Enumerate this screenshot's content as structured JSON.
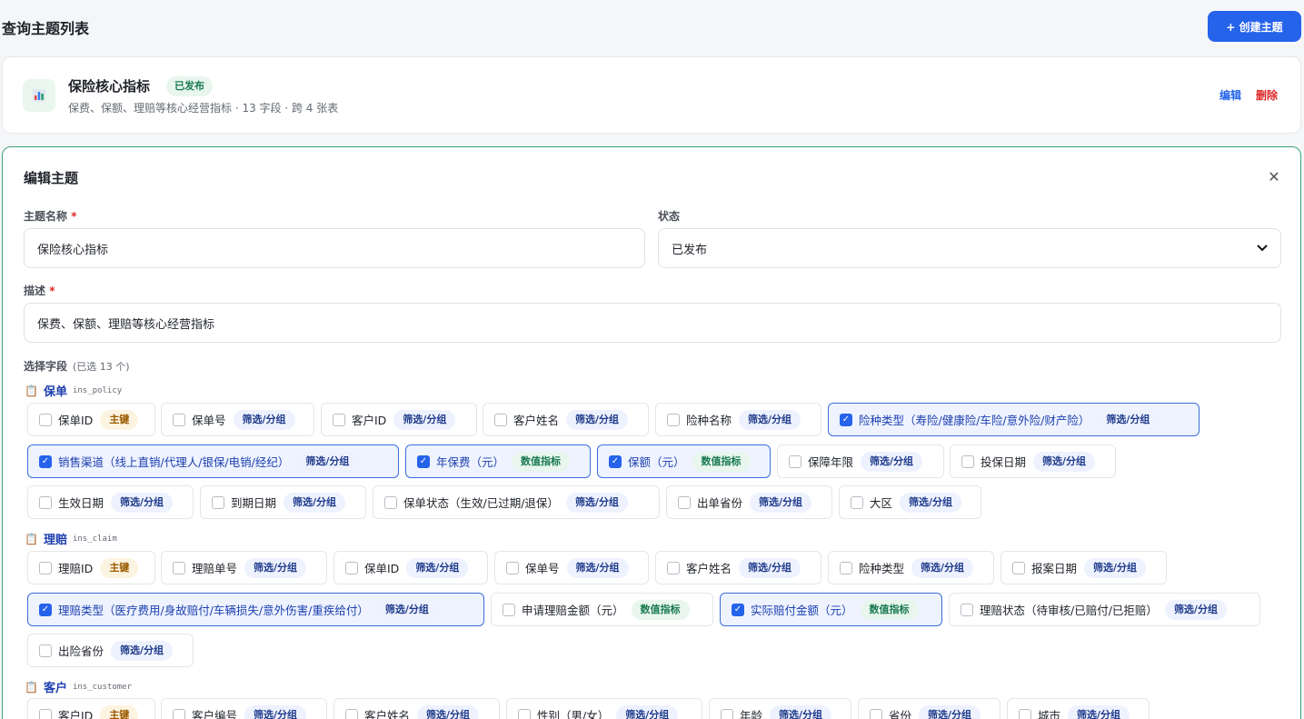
{
  "header": {
    "title": "查询主题列表",
    "create_button": "+ 创建主题"
  },
  "topic": {
    "name": "保险核心指标",
    "status_badge": "已发布",
    "description": "保费、保额、理赔等核心经营指标 · 13 字段 · 跨 4 张表",
    "edit_label": "编辑",
    "delete_label": "删除"
  },
  "editor": {
    "title": "编辑主题",
    "name_label": "主题名称",
    "required_mark": "*",
    "name_value": "保险核心指标",
    "status_label": "状态",
    "status_value": "已发布",
    "desc_label": "描述",
    "desc_value": "保费、保额、理赔等核心经营指标",
    "fields_label": "选择字段",
    "fields_count": "(已选 13 个)"
  },
  "groups": [
    {
      "name": "保单",
      "table": "ins_policy",
      "fields": [
        {
          "label": "保单ID",
          "tag": "主键",
          "tag_type": "key",
          "checked": false
        },
        {
          "label": "保单号",
          "tag": "筛选/分组",
          "tag_type": "filter",
          "checked": false
        },
        {
          "label": "客户ID",
          "tag": "筛选/分组",
          "tag_type": "filter",
          "checked": false
        },
        {
          "label": "客户姓名",
          "tag": "筛选/分组",
          "tag_type": "filter",
          "checked": false
        },
        {
          "label": "险种名称",
          "tag": "筛选/分组",
          "tag_type": "filter",
          "checked": false
        },
        {
          "label": "险种类型（寿险/健康险/车险/意外险/财产险）",
          "tag": "筛选/分组",
          "tag_type": "filter",
          "checked": true
        },
        {
          "label": "销售渠道（线上直销/代理人/银保/电销/经纪）",
          "tag": "筛选/分组",
          "tag_type": "filter",
          "checked": true
        },
        {
          "label": "年保费（元）",
          "tag": "数值指标",
          "tag_type": "metric",
          "checked": true
        },
        {
          "label": "保额（元）",
          "tag": "数值指标",
          "tag_type": "metric",
          "checked": true
        },
        {
          "label": "保障年限",
          "tag": "筛选/分组",
          "tag_type": "filter",
          "checked": false
        },
        {
          "label": "投保日期",
          "tag": "筛选/分组",
          "tag_type": "filter",
          "checked": false
        },
        {
          "label": "生效日期",
          "tag": "筛选/分组",
          "tag_type": "filter",
          "checked": false
        },
        {
          "label": "到期日期",
          "tag": "筛选/分组",
          "tag_type": "filter",
          "checked": false
        },
        {
          "label": "保单状态（生效/已过期/退保）",
          "tag": "筛选/分组",
          "tag_type": "filter",
          "checked": false
        },
        {
          "label": "出单省份",
          "tag": "筛选/分组",
          "tag_type": "filter",
          "checked": false
        },
        {
          "label": "大区",
          "tag": "筛选/分组",
          "tag_type": "filter",
          "checked": false
        }
      ]
    },
    {
      "name": "理赔",
      "table": "ins_claim",
      "fields": [
        {
          "label": "理赔ID",
          "tag": "主键",
          "tag_type": "key",
          "checked": false
        },
        {
          "label": "理赔单号",
          "tag": "筛选/分组",
          "tag_type": "filter",
          "checked": false
        },
        {
          "label": "保单ID",
          "tag": "筛选/分组",
          "tag_type": "filter",
          "checked": false
        },
        {
          "label": "保单号",
          "tag": "筛选/分组",
          "tag_type": "filter",
          "checked": false
        },
        {
          "label": "客户姓名",
          "tag": "筛选/分组",
          "tag_type": "filter",
          "checked": false
        },
        {
          "label": "险种类型",
          "tag": "筛选/分组",
          "tag_type": "filter",
          "checked": false
        },
        {
          "label": "报案日期",
          "tag": "筛选/分组",
          "tag_type": "filter",
          "checked": false
        },
        {
          "label": "理赔类型（医疗费用/身故赔付/车辆损失/意外伤害/重疾给付）",
          "tag": "筛选/分组",
          "tag_type": "filter",
          "checked": true
        },
        {
          "label": "申请理赔金额（元）",
          "tag": "数值指标",
          "tag_type": "metric",
          "checked": false
        },
        {
          "label": "实际赔付金额（元）",
          "tag": "数值指标",
          "tag_type": "metric",
          "checked": true
        },
        {
          "label": "理赔状态（待审核/已赔付/已拒赔）",
          "tag": "筛选/分组",
          "tag_type": "filter",
          "checked": false
        },
        {
          "label": "出险省份",
          "tag": "筛选/分组",
          "tag_type": "filter",
          "checked": false
        }
      ]
    },
    {
      "name": "客户",
      "table": "ins_customer",
      "fields": [
        {
          "label": "客户ID",
          "tag": "主键",
          "tag_type": "key",
          "checked": false
        },
        {
          "label": "客户编号",
          "tag": "筛选/分组",
          "tag_type": "filter",
          "checked": false
        },
        {
          "label": "客户姓名",
          "tag": "筛选/分组",
          "tag_type": "filter",
          "checked": false
        },
        {
          "label": "性别（男/女）",
          "tag": "筛选/分组",
          "tag_type": "filter",
          "checked": false
        },
        {
          "label": "年龄",
          "tag": "筛选/分组",
          "tag_type": "filter",
          "checked": false
        },
        {
          "label": "省份",
          "tag": "筛选/分组",
          "tag_type": "filter",
          "checked": false
        },
        {
          "label": "城市",
          "tag": "筛选/分组",
          "tag_type": "filter",
          "checked": false
        }
      ]
    }
  ]
}
